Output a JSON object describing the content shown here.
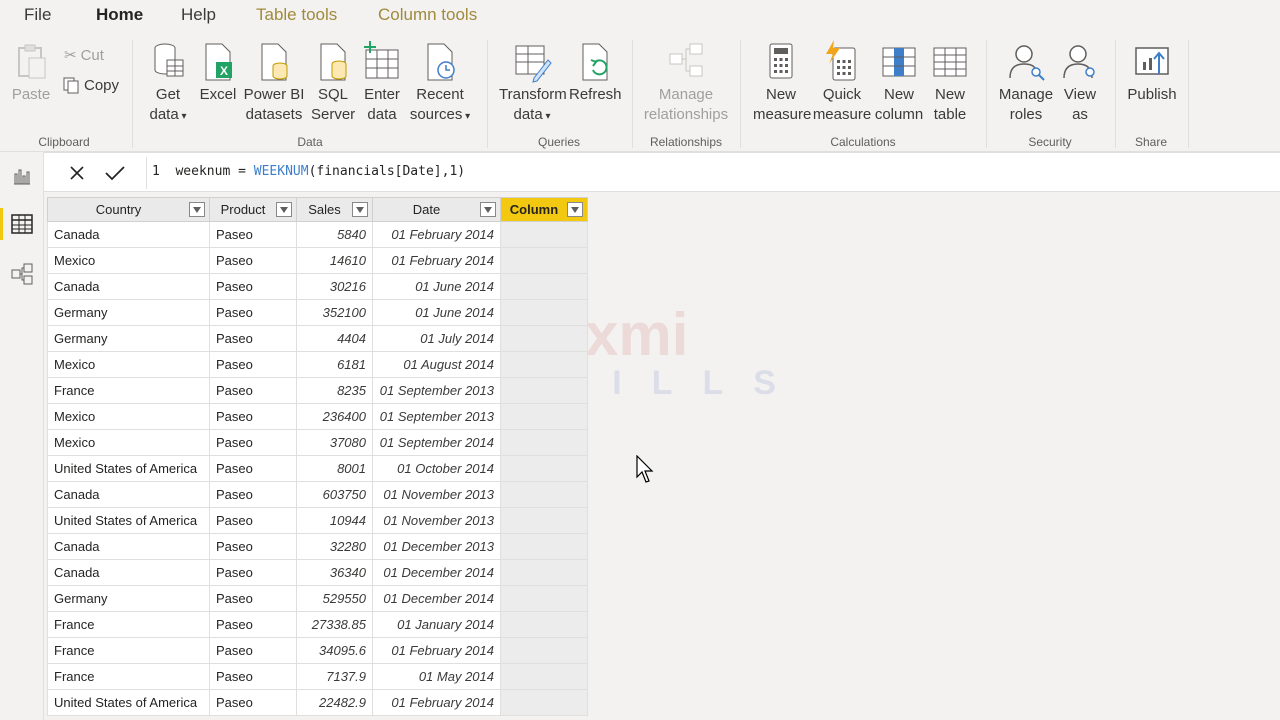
{
  "tabs": [
    {
      "label": "File",
      "style": "normal"
    },
    {
      "label": "Home",
      "style": "active"
    },
    {
      "label": "Help",
      "style": "normal"
    },
    {
      "label": "Table tools",
      "style": "context"
    },
    {
      "label": "Column tools",
      "style": "context"
    }
  ],
  "ribbon": {
    "clipboard": {
      "paste": "Paste",
      "cut": "Cut",
      "copy": "Copy",
      "label": "Clipboard"
    },
    "data": {
      "get_data": [
        "Get",
        "data"
      ],
      "excel": "Excel",
      "powerbi": [
        "Power BI",
        "datasets"
      ],
      "sql": [
        "SQL",
        "Server"
      ],
      "enter": [
        "Enter",
        "data"
      ],
      "recent": [
        "Recent",
        "sources"
      ],
      "label": "Data"
    },
    "queries": {
      "transform": [
        "Transform",
        "data"
      ],
      "refresh": "Refresh",
      "label": "Queries"
    },
    "relationships": {
      "manage": [
        "Manage",
        "relationships"
      ],
      "label": "Relationships"
    },
    "calculations": {
      "new_measure": [
        "New",
        "measure"
      ],
      "quick_measure": [
        "Quick",
        "measure"
      ],
      "new_column": [
        "New",
        "column"
      ],
      "new_table": [
        "New",
        "table"
      ],
      "label": "Calculations"
    },
    "security": {
      "manage_roles": [
        "Manage",
        "roles"
      ],
      "view_as": [
        "View",
        "as"
      ],
      "label": "Security"
    },
    "share": {
      "publish": "Publish",
      "label": "Share"
    }
  },
  "formula": {
    "line": "1",
    "prefix": "weeknum = ",
    "function": "WEEKNUM",
    "args": "(financials[Date],1)"
  },
  "table": {
    "headers": [
      "Country",
      "Product",
      "Sales",
      "Date",
      "Column"
    ],
    "rows": [
      [
        "Canada",
        "Paseo",
        "5840",
        "01 February 2014"
      ],
      [
        "Mexico",
        "Paseo",
        "14610",
        "01 February 2014"
      ],
      [
        "Canada",
        "Paseo",
        "30216",
        "01 June 2014"
      ],
      [
        "Germany",
        "Paseo",
        "352100",
        "01 June 2014"
      ],
      [
        "Germany",
        "Paseo",
        "4404",
        "01 July 2014"
      ],
      [
        "Mexico",
        "Paseo",
        "6181",
        "01 August 2014"
      ],
      [
        "France",
        "Paseo",
        "8235",
        "01 September 2013"
      ],
      [
        "Mexico",
        "Paseo",
        "236400",
        "01 September 2013"
      ],
      [
        "Mexico",
        "Paseo",
        "37080",
        "01 September 2014"
      ],
      [
        "United States of America",
        "Paseo",
        "8001",
        "01 October 2014"
      ],
      [
        "Canada",
        "Paseo",
        "603750",
        "01 November 2013"
      ],
      [
        "United States of America",
        "Paseo",
        "10944",
        "01 November 2013"
      ],
      [
        "Canada",
        "Paseo",
        "32280",
        "01 December 2013"
      ],
      [
        "Canada",
        "Paseo",
        "36340",
        "01 December 2014"
      ],
      [
        "Germany",
        "Paseo",
        "529550",
        "01 December 2014"
      ],
      [
        "France",
        "Paseo",
        "27338.85",
        "01 January 2014"
      ],
      [
        "France",
        "Paseo",
        "34095.6",
        "01 February 2014"
      ],
      [
        "France",
        "Paseo",
        "7137.9",
        "01 May 2014"
      ],
      [
        "United States of America",
        "Paseo",
        "22482.9",
        "01 February 2014"
      ]
    ]
  },
  "watermark": {
    "line1": "Laxmi",
    "line2": "SKILLS"
  },
  "colors": {
    "accent": "#f2c811",
    "function": "#3f7fc9"
  }
}
